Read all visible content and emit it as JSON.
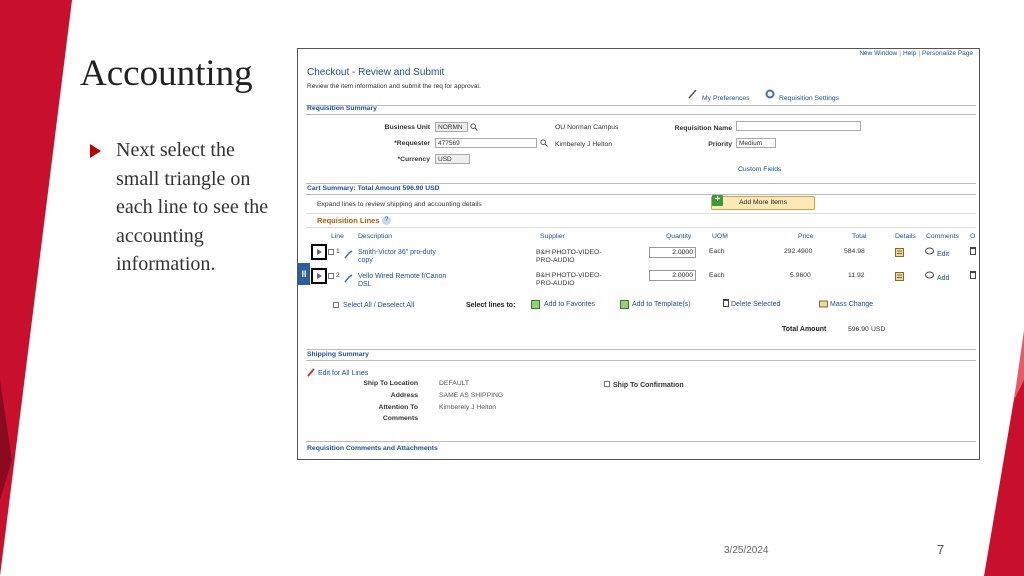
{
  "slide": {
    "title": "Accounting",
    "bullet": "Next select the small triangle on each line to see the accounting information.",
    "date": "3/25/2024",
    "page_number": "7"
  },
  "colors": {
    "accent": "#c00000",
    "link": "#1a4f9c",
    "section_orange": "#b35a00"
  },
  "screen": {
    "top_links": [
      "New Window",
      "Help",
      "Personalize Page"
    ],
    "page_title": "Checkout - Review and Submit",
    "instructions": "Review the item information and submit the req for approval.",
    "my_preferences": "My Preferences",
    "requisition_settings": "Requisition Settings",
    "requisition_summary": {
      "title": "Requisition Summary",
      "business_unit_label": "Business Unit",
      "business_unit": "NORMN",
      "business_unit_desc": "OU Norman Campus",
      "requester_label": "*Requester",
      "requester": "477569",
      "requester_name": "Kimberely J Helton",
      "currency_label": "*Currency",
      "currency": "USD",
      "requisition_name_label": "Requisition Name",
      "requisition_name": "",
      "priority_label": "Priority",
      "priority": "Medium",
      "custom_fields": "Custom Fields"
    },
    "cart": {
      "summary": "Cart Summary: Total Amount 596.90 USD",
      "expand_text": "Expand lines to review shipping and accounting details",
      "add_more_items": "Add More Items",
      "requisition_lines": "Requisition Lines",
      "help": "?",
      "columns": [
        "Line",
        "Description",
        "Supplier",
        "Quantity",
        "UOM",
        "Price",
        "Total",
        "Details",
        "Comments",
        "O"
      ],
      "lines": [
        {
          "line": "1",
          "description": "Smith-Victor 36\" pro-duty copy",
          "description_1": "Smith-Victor 36\" pro-duty",
          "description_2": "copy",
          "supplier_1": "B&H PHOTO-VIDEO-",
          "supplier_2": "PRO-AUDIO",
          "quantity": "2.0000",
          "uom": "Each",
          "price": "292.4900",
          "total": "584.98",
          "comment": "Edit"
        },
        {
          "line": "2",
          "description": "Vello Wired Remote f/Canon DSL",
          "description_1": "Vello Wired Remote f/Canon",
          "description_2": "DSL",
          "supplier_1": "B&H PHOTO-VIDEO-",
          "supplier_2": "PRO-AUDIO",
          "quantity": "2.0000",
          "uom": "Each",
          "price": "5.9600",
          "total": "11.92",
          "comment": "Add"
        }
      ],
      "select_all": "Select All / Deselect All",
      "select_lines_to": "Select lines to:",
      "add_to_favorites": "Add to Favorites",
      "add_to_templates": "Add to Template(s)",
      "delete_selected": "Delete Selected",
      "mass_change": "Mass Change",
      "total_amount_label": "Total Amount",
      "total_amount": "596.90",
      "total_currency": "USD"
    },
    "shipping": {
      "title": "Shipping Summary",
      "edit_all": "Edit for All Lines",
      "ship_to_location_label": "Ship To Location",
      "ship_to_location": "DEFAULT",
      "address_label": "Address",
      "address": "SAME AS SHIPPING",
      "attention_label": "Attention To",
      "attention": "Kimberely J Helton",
      "comments_label": "Comments",
      "ship_to_confirmation": "Ship To Confirmation"
    },
    "comments_attachments": "Requisition Comments and Attachments"
  }
}
